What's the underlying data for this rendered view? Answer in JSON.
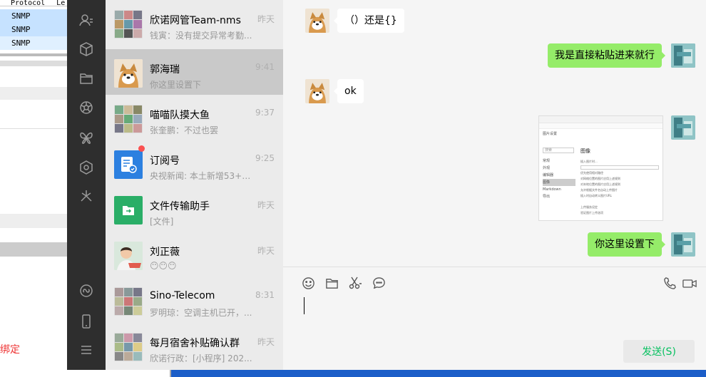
{
  "background_app": {
    "column_header": "Protocol",
    "column_header_2": "Le",
    "rows": [
      "SNMP",
      "SNMP",
      "SNMP"
    ],
    "red_text": "绑定"
  },
  "nav": {
    "icons": [
      "contacts-icon",
      "cube-icon",
      "folder-icon",
      "aperture-icon",
      "butterfly-icon",
      "hexagon-icon",
      "sparkle-icon"
    ],
    "bottom_icons": [
      "mini-program-icon",
      "phone-icon",
      "menu-icon"
    ]
  },
  "chats": [
    {
      "name": "欣诺网管Team-nms",
      "time": "昨天",
      "preview": "钱寅：没有提交异常考勤..."
    },
    {
      "name": "郭海瑞",
      "time": "9:41",
      "preview": "你这里设置下",
      "selected": true
    },
    {
      "name": "喵喵队摸大鱼",
      "time": "9:37",
      "preview": "张奎鹏：不过也罢"
    },
    {
      "name": "订阅号",
      "time": "9:25",
      "preview": "央视新闻: 本土新增53+2...",
      "badge": true
    },
    {
      "name": "文件传输助手",
      "time": "昨天",
      "preview": "[文件]"
    },
    {
      "name": "刘正薇",
      "time": "昨天",
      "preview": "😶😶😶"
    },
    {
      "name": "Sino-Telecom",
      "time": "8:31",
      "preview": "罗明琼：空调主机已开，..."
    },
    {
      "name": "每月宿舍补贴确认群",
      "time": "昨天",
      "preview": "欣诺行政：[小程序] 202..."
    }
  ],
  "messages": [
    {
      "side": "left",
      "text": "（）还是{}"
    },
    {
      "side": "right",
      "text": "我是直接粘贴进来就行"
    },
    {
      "side": "left",
      "text": "ok"
    },
    {
      "side": "right",
      "text": "[image]",
      "image": true
    },
    {
      "side": "right",
      "text": "你这里设置下"
    }
  ],
  "screenshot_preview": {
    "title": "图像",
    "heading": "图片设置",
    "search": "搜索",
    "menu": [
      "常规",
      "外观",
      "编辑器",
      "图像",
      "Markdown",
      "导出"
    ],
    "options": [
      "插入图片时...",
      "优先使用相对路径",
      "对网络位置的图片应用上述规则",
      "对本地位置的图片应用上述规则",
      "允许根据文件名自动上传图片",
      "插入时自动转义图片URL",
      "上传服务设定",
      "验证图片上传选项"
    ]
  },
  "toolbar": {
    "emoji": "emoji-icon",
    "file": "folder-icon",
    "cut": "scissors-icon",
    "chat": "chat-history-icon",
    "call": "phone-call-icon",
    "video": "video-call-icon"
  },
  "send_label": "发送(S)",
  "colors": {
    "nav_bg": "#2e2e2e",
    "list_bg": "#ebebeb",
    "selected_bg": "#c9c9c9",
    "bubble_green": "#95ec69",
    "send_text": "#07c160",
    "badge": "#fa5151"
  }
}
